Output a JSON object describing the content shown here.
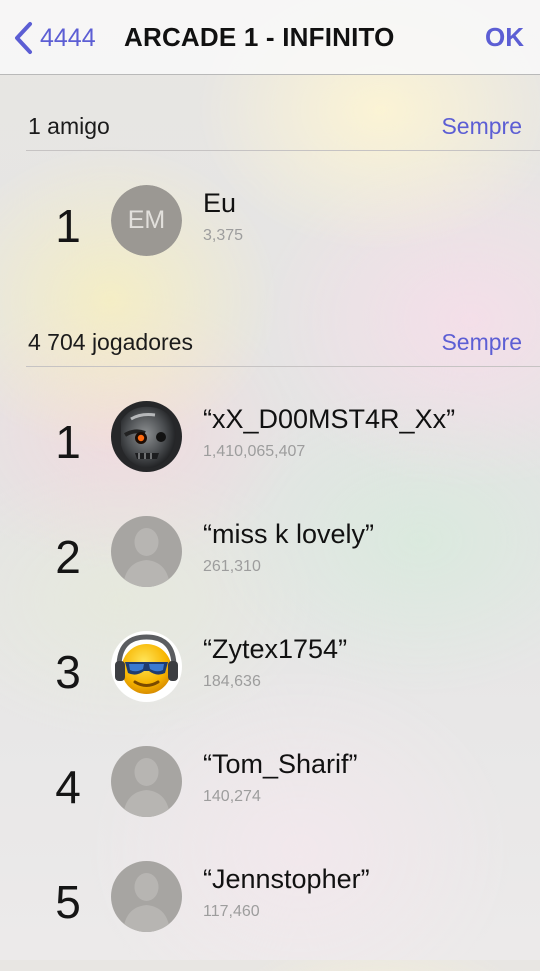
{
  "navbar": {
    "back_label": "4444",
    "title": "ARCADE 1 - INFINITO",
    "done_label": "OK"
  },
  "friends": {
    "header": "1 amigo",
    "filter": "Sempre",
    "entries": [
      {
        "rank": "1",
        "initials": "EM",
        "name": "Eu",
        "score": "3,375"
      }
    ]
  },
  "players": {
    "header": "4 704 jogadores",
    "filter": "Sempre",
    "entries": [
      {
        "rank": "1",
        "name": "“xX_D00MST4R_Xx”",
        "score": "1,410,065,407",
        "avatar": "skull-mask-photo"
      },
      {
        "rank": "2",
        "name": "“miss k lovely”",
        "score": "261,310",
        "avatar": "default-silhouette"
      },
      {
        "rank": "3",
        "name": "“Zytex1754”",
        "score": "184,636",
        "avatar": "emoji-sunglasses-headphones"
      },
      {
        "rank": "4",
        "name": "“Tom_Sharif”",
        "score": "140,274",
        "avatar": "default-silhouette"
      },
      {
        "rank": "5",
        "name": "“Jennstopher”",
        "score": "117,460",
        "avatar": "default-silhouette"
      }
    ]
  },
  "colors": {
    "accent": "#5c5ed4",
    "text": "#111111",
    "score": "#9d9d9d"
  }
}
